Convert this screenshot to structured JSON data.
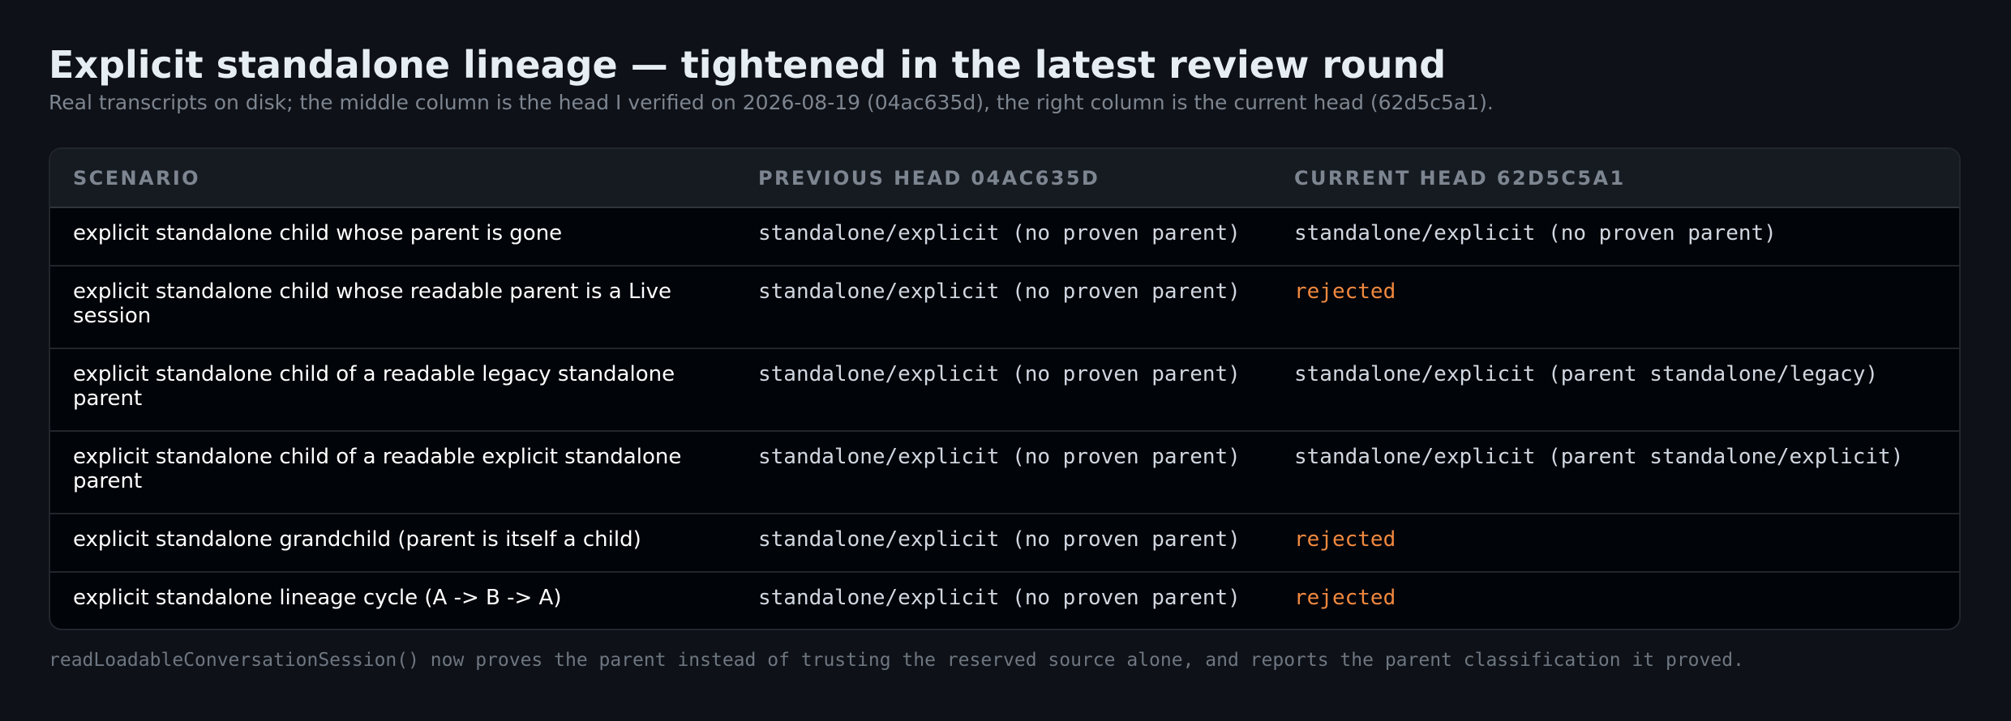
{
  "header": {
    "title": "Explicit standalone lineage — tightened in the latest review round",
    "subtitle": "Real transcripts on disk; the middle column is the head I verified on 2026-08-19 (04ac635d), the right column is the current head (62d5c5a1)."
  },
  "table": {
    "columns": [
      "SCENARIO",
      "PREVIOUS HEAD 04AC635D",
      "CURRENT HEAD 62D5C5A1"
    ],
    "rows": [
      {
        "scenario": "explicit standalone child whose parent is gone",
        "previous": "standalone/explicit (no proven parent)",
        "current": "standalone/explicit (no proven parent)",
        "current_status": "ok"
      },
      {
        "scenario": "explicit standalone child whose readable parent is a Live session",
        "previous": "standalone/explicit (no proven parent)",
        "current": "rejected",
        "current_status": "rejected"
      },
      {
        "scenario": "explicit standalone child of a readable legacy standalone parent",
        "previous": "standalone/explicit (no proven parent)",
        "current": "standalone/explicit (parent standalone/legacy)",
        "current_status": "ok"
      },
      {
        "scenario": "explicit standalone child of a readable explicit standalone parent",
        "previous": "standalone/explicit (no proven parent)",
        "current": "standalone/explicit (parent standalone/explicit)",
        "current_status": "ok"
      },
      {
        "scenario": "explicit standalone grandchild (parent is itself a child)",
        "previous": "standalone/explicit (no proven parent)",
        "current": "rejected",
        "current_status": "rejected"
      },
      {
        "scenario": "explicit standalone lineage cycle (A -> B -> A)",
        "previous": "standalone/explicit (no proven parent)",
        "current": "rejected",
        "current_status": "rejected"
      }
    ]
  },
  "footnote": "readLoadableConversationSession() now proves the parent instead of trusting the reserved source alone, and reports the parent classification it proved.",
  "colors": {
    "background": "#0e1117",
    "rejected": "#f0883e",
    "header_text": "#7d8590"
  }
}
